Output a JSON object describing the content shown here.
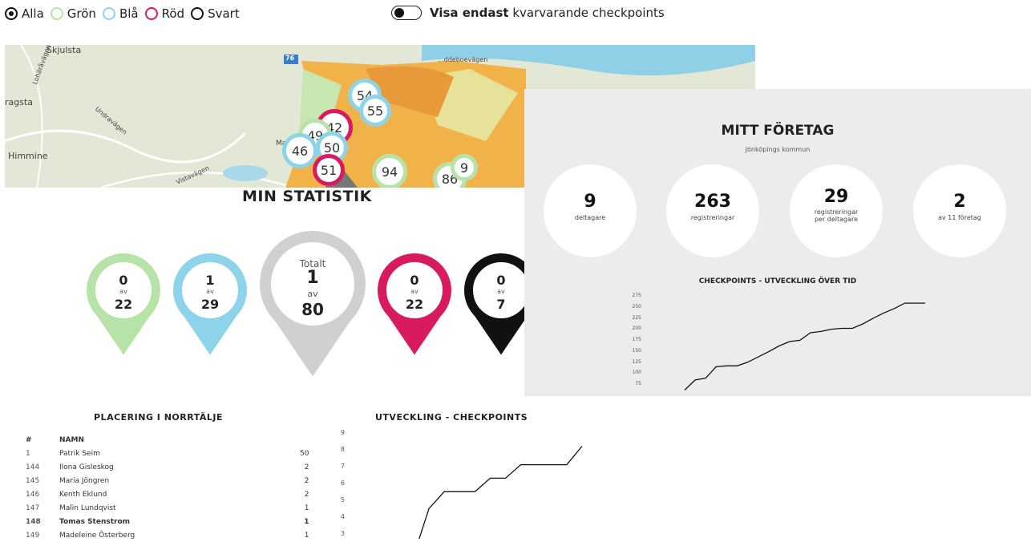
{
  "filters": {
    "options": [
      {
        "label": "Alla",
        "color": "#111111",
        "checked": true
      },
      {
        "label": "Grön",
        "color": "#b8e3a8",
        "checked": false
      },
      {
        "label": "Blå",
        "color": "#8dd3ea",
        "checked": false
      },
      {
        "label": "Röd",
        "color": "#d81b60",
        "checked": false
      },
      {
        "label": "Svart",
        "color": "#111111",
        "checked": false
      }
    ],
    "toggle_bold": "Visa endast",
    "toggle_rest": "kvarvarande checkpoints"
  },
  "map": {
    "place_labels": [
      "Skjulsta",
      "ragsta",
      "Himmine",
      "Mal"
    ],
    "road_labels": [
      "Lohäråvägen",
      "Undravägen",
      "Vistavägen",
      "...ddeboevägen"
    ],
    "road_number": "76",
    "clusters": [
      "54",
      "55",
      "42",
      "49",
      "46",
      "50",
      "51",
      "94",
      "86",
      "9"
    ]
  },
  "my_stats": {
    "title": "MIN STATISTIK",
    "pins": [
      {
        "name": "gron",
        "color": "#b8e3a8",
        "value": "0",
        "of": "av",
        "total": "22"
      },
      {
        "name": "bla",
        "color": "#8dd3ea",
        "value": "1",
        "of": "av",
        "total": "29"
      },
      {
        "name": "totalt",
        "color": "#d0d0d0",
        "label": "Totalt",
        "value": "1",
        "of": "av",
        "total": "80"
      },
      {
        "name": "rod",
        "color": "#d81b60",
        "value": "0",
        "of": "av",
        "total": "22"
      },
      {
        "name": "svart",
        "color": "#111111",
        "value": "0",
        "of": "av",
        "total": "7"
      }
    ]
  },
  "company": {
    "title": "MITT FÖRETAG",
    "subtitle": "Jönköpings kommun",
    "stats": [
      {
        "value": "9",
        "label": "deltagare"
      },
      {
        "value": "263",
        "label": "registreringar"
      },
      {
        "value": "29",
        "label": "registreringar per deltagare"
      },
      {
        "value": "2",
        "label": "av 11 företag"
      }
    ],
    "chart_title": "CHECKPOINTS - UTVECKLING ÖVER TID"
  },
  "placement": {
    "title": "PLACERING I NORRTÄLJE",
    "headers": [
      "#",
      "NAMN"
    ],
    "rows": [
      {
        "rank": "1",
        "name": "Patrik Seim",
        "count": "50",
        "bold": false
      },
      {
        "rank": "144",
        "name": "Ilona Gisleskog",
        "count": "2",
        "bold": false
      },
      {
        "rank": "145",
        "name": "Maria Jöngren",
        "count": "2",
        "bold": false
      },
      {
        "rank": "146",
        "name": "Kenth Eklund",
        "count": "2",
        "bold": false
      },
      {
        "rank": "147",
        "name": "Malin Lundqvist",
        "count": "1",
        "bold": false
      },
      {
        "rank": "148",
        "name": "Tomas Stenstrom",
        "count": "1",
        "bold": true
      },
      {
        "rank": "149",
        "name": "Madeleine Österberg",
        "count": "1",
        "bold": false
      }
    ]
  },
  "development": {
    "title": "UTVECKLING - CHECKPOINTS"
  },
  "chart_data": [
    {
      "type": "line",
      "title": "CHECKPOINTS - UTVECKLING ÖVER TID",
      "y_ticks": [
        "275",
        "250",
        "225",
        "200",
        "175",
        "150",
        "125",
        "100",
        "75"
      ],
      "ylim": [
        75,
        275
      ],
      "x": [
        0,
        1,
        2,
        3,
        4,
        5,
        6,
        7,
        8,
        9,
        10,
        11,
        12,
        13,
        14,
        15,
        16,
        17,
        18,
        19,
        20,
        21,
        22,
        23,
        24,
        25,
        26
      ],
      "values": [
        65,
        88,
        92,
        118,
        120,
        120,
        128,
        140,
        152,
        165,
        175,
        178,
        195,
        198,
        203,
        205,
        205,
        215,
        228,
        240,
        250,
        262,
        262,
        262,
        262,
        262,
        262
      ]
    },
    {
      "type": "line",
      "title": "UTVECKLING - CHECKPOINTS",
      "y_ticks": [
        "9",
        "8",
        "7",
        "6",
        "5",
        "4",
        "3"
      ],
      "ylim": [
        3,
        9
      ],
      "x": [
        0,
        1,
        2,
        3,
        4,
        5,
        6,
        7,
        8,
        9,
        10,
        11
      ],
      "values": [
        2,
        4.8,
        5.8,
        5.8,
        5.8,
        6.6,
        6.6,
        7.4,
        7.4,
        7.4,
        7.4,
        8.5
      ]
    }
  ]
}
